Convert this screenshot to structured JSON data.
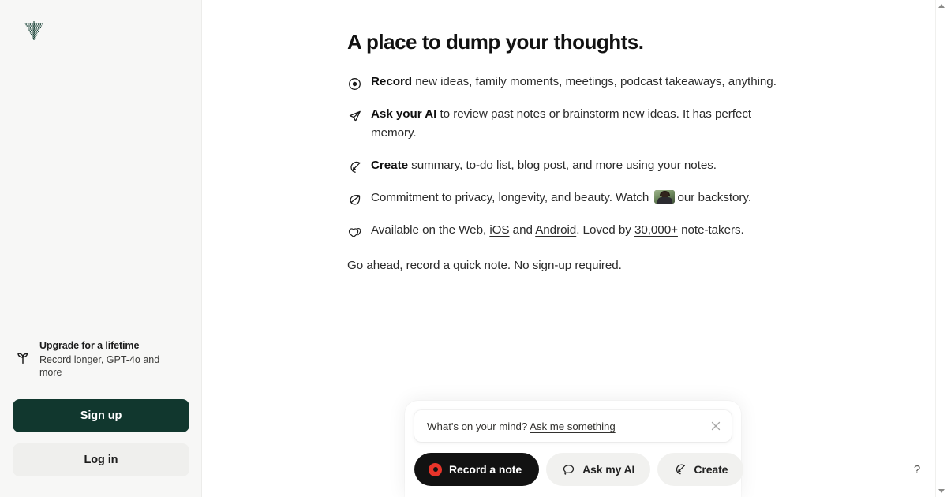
{
  "brand": {
    "logo_icon": "feather-leaf-logo",
    "accent_green": "#11372e",
    "record_red": "#e8342a"
  },
  "sidebar": {
    "upgrade": {
      "icon": "sprout-icon",
      "title": "Upgrade for a lifetime",
      "subtitle": "Record longer, GPT-4o and more"
    },
    "signup_label": "Sign up",
    "login_label": "Log in"
  },
  "main": {
    "title": "A place to dump your thoughts.",
    "bullets": [
      {
        "icon": "record-circle-icon",
        "lead": "Record",
        "rest": " new ideas, family moments, meetings, podcast takeaways, ",
        "link": "anything",
        "tail": "."
      },
      {
        "icon": "send-arrow-icon",
        "lead": "Ask your AI",
        "rest": " to review past notes or brainstorm new ideas. It has perfect memory.",
        "link": "",
        "tail": ""
      },
      {
        "icon": "magic-wand-icon",
        "lead": "Create",
        "rest": " summary, to-do list, blog post, and more using your notes.",
        "link": "",
        "tail": ""
      }
    ],
    "commitment": {
      "icon": "leaf-icon",
      "prefix": "Commitment to ",
      "link_privacy": "privacy",
      "sep1": ", ",
      "link_longevity": "longevity",
      "sep2": ", and ",
      "link_beauty": "beauty",
      "watch_text": ". Watch ",
      "thumbnail": "backstory-video-thumbnail",
      "link_backstory": "our backstory",
      "suffix": "."
    },
    "availability": {
      "icon": "double-heart-icon",
      "prefix": "Available on the Web, ",
      "link_ios": "iOS",
      "sep": " and ",
      "link_android": "Android",
      "loved_prefix": ". Loved by ",
      "link_count": "30,000+",
      "suffix": " note-takers."
    },
    "closing": "Go ahead, record a quick note. No sign-up required."
  },
  "composer": {
    "prompt_prefix": "What's on your mind? ",
    "prompt_link": "Ask me something",
    "close_icon": "close-x-icon",
    "buttons": [
      {
        "id": "record",
        "icon": "record-dot-icon",
        "label": "Record a note"
      },
      {
        "id": "ask",
        "icon": "speech-bubble-icon",
        "label": "Ask my AI"
      },
      {
        "id": "create",
        "icon": "magic-wand-icon",
        "label": "Create"
      }
    ]
  },
  "help": {
    "label": "?",
    "icon": "question-mark-icon"
  },
  "scrollbar": {
    "up_icon": "scroll-up-arrow-icon",
    "down_icon": "scroll-down-arrow-icon"
  }
}
